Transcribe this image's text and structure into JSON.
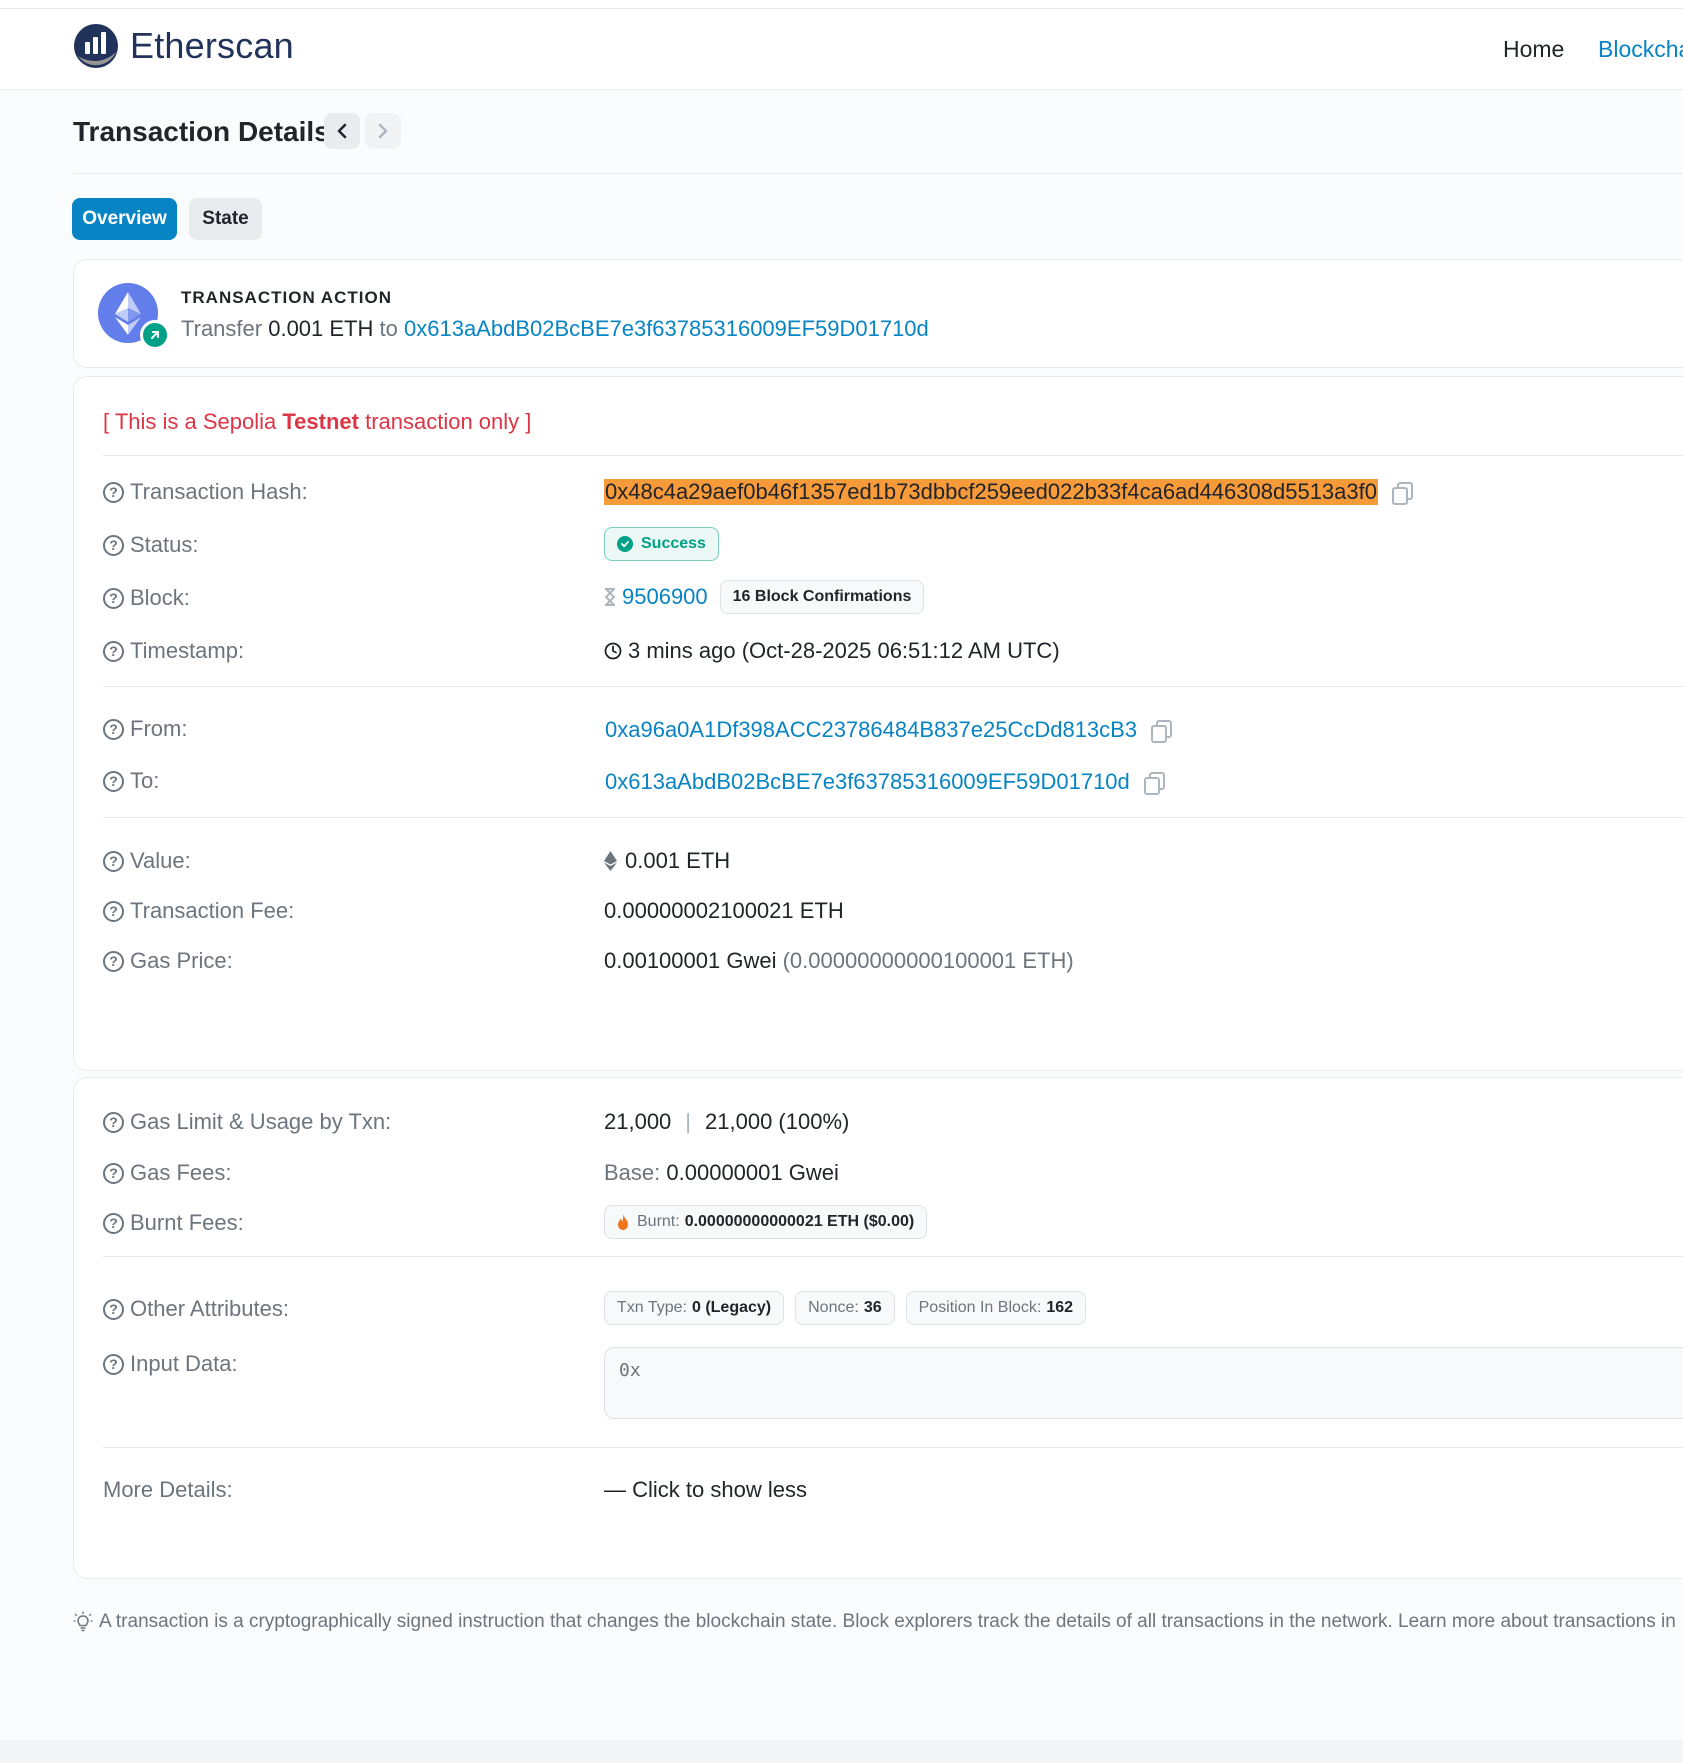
{
  "header": {
    "brand": "Etherscan",
    "nav": {
      "home": "Home",
      "blockchain": "Blockcha"
    }
  },
  "page": {
    "title": "Transaction Details",
    "tabs": {
      "overview": "Overview",
      "state": "State"
    }
  },
  "action": {
    "label": "TRANSACTION ACTION",
    "verb": "Transfer",
    "amount": "0.001 ETH",
    "to_word": "to",
    "to_address": "0x613aAbdB02BcBE7e3f63785316009EF59D01710d"
  },
  "testnet_notice": {
    "open": "[ This is a Sepolia ",
    "bold": "Testnet",
    "close": " transaction only ]"
  },
  "fields": {
    "hash": {
      "label": "Transaction Hash:",
      "value": "0x48c4a29aef0b46f1357ed1b73dbbcf259eed022b33f4ca6ad446308d5513a3f0"
    },
    "status": {
      "label": "Status:",
      "value": "Success"
    },
    "block": {
      "label": "Block:",
      "value": "9506900",
      "confirmations": "16 Block Confirmations"
    },
    "timestamp": {
      "label": "Timestamp:",
      "value": "3 mins ago (Oct-28-2025 06:51:12 AM UTC)"
    },
    "from": {
      "label": "From:",
      "value": "0xa96a0A1Df398ACC23786484B837e25CcDd813cB3"
    },
    "to": {
      "label": "To:",
      "value": "0x613aAbdB02BcBE7e3f63785316009EF59D01710d"
    },
    "value": {
      "label": "Value:",
      "value": "0.001 ETH"
    },
    "fee": {
      "label": "Transaction Fee:",
      "value": "0.00000002100021 ETH"
    },
    "gas_price": {
      "label": "Gas Price:",
      "value": "0.00100001 Gwei",
      "eth": "(0.00000000000100001 ETH)"
    },
    "gas_limit": {
      "label": "Gas Limit & Usage by Txn:",
      "limit": "21,000",
      "usage": "21,000 (100%)"
    },
    "gas_fees": {
      "label": "Gas Fees:",
      "base_label": "Base:",
      "base_value": "0.00000001 Gwei"
    },
    "burnt": {
      "label": "Burnt Fees:",
      "prefix": "Burnt:",
      "value": "0.00000000000021 ETH ($0.00)"
    },
    "other": {
      "label": "Other Attributes:",
      "txn_type_label": "Txn Type:",
      "txn_type_value": "0 (Legacy)",
      "nonce_label": "Nonce:",
      "nonce_value": "36",
      "position_label": "Position In Block:",
      "position_value": "162"
    },
    "input": {
      "label": "Input Data:",
      "value": "0x"
    },
    "more": {
      "label": "More Details:",
      "link": "— Click to show less"
    }
  },
  "footer_note": "A transaction is a cryptographically signed instruction that changes the blockchain state. Block explorers track the details of all transactions in the network. Learn more about transactions in",
  "colors": {
    "accent": "#0784c3",
    "success": "#00a186",
    "danger": "#dc3545",
    "highlight": "#f79a3a"
  }
}
